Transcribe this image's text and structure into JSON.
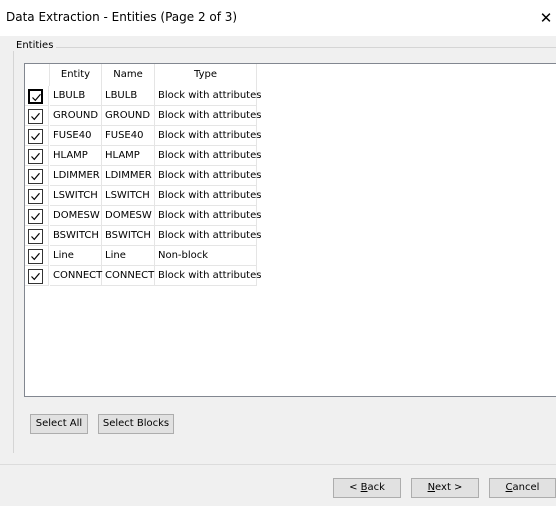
{
  "window": {
    "title": "Data Extraction - Entities (Page 2 of 3)",
    "close_glyph": "✕"
  },
  "group": {
    "label": "Entities"
  },
  "table": {
    "columns": [
      "Entity",
      "Name",
      "Type"
    ],
    "rows": [
      {
        "checked": true,
        "entity": "LBULB",
        "name": "LBULB",
        "type": "Block with attributes"
      },
      {
        "checked": true,
        "entity": "GROUND",
        "name": "GROUND",
        "type": "Block with attributes"
      },
      {
        "checked": true,
        "entity": "FUSE40",
        "name": "FUSE40",
        "type": "Block with attributes"
      },
      {
        "checked": true,
        "entity": "HLAMP",
        "name": "HLAMP",
        "type": "Block with attributes"
      },
      {
        "checked": true,
        "entity": "LDIMMER",
        "name": "LDIMMER",
        "type": "Block with attributes"
      },
      {
        "checked": true,
        "entity": "LSWITCH",
        "name": "LSWITCH",
        "type": "Block with attributes"
      },
      {
        "checked": true,
        "entity": "DOMESW",
        "name": "DOMESW",
        "type": "Block with attributes"
      },
      {
        "checked": true,
        "entity": "BSWITCH",
        "name": "BSWITCH",
        "type": "Block with attributes"
      },
      {
        "checked": true,
        "entity": "Line",
        "name": "Line",
        "type": "Non-block"
      },
      {
        "checked": true,
        "entity": "CONNECT",
        "name": "CONNECT",
        "type": "Block with attributes"
      }
    ]
  },
  "buttons": {
    "select_all": "Select All",
    "select_blocks": "Select Blocks",
    "back": {
      "prefix": "< ",
      "mnemonic": "B",
      "rest": "ack"
    },
    "next": {
      "mnemonic": "N",
      "rest": "ext >"
    },
    "cancel": {
      "mnemonic": "C",
      "rest": "ancel"
    }
  },
  "colors": {
    "accent_check": "#000000",
    "window_bg": "#f0f0f0"
  }
}
